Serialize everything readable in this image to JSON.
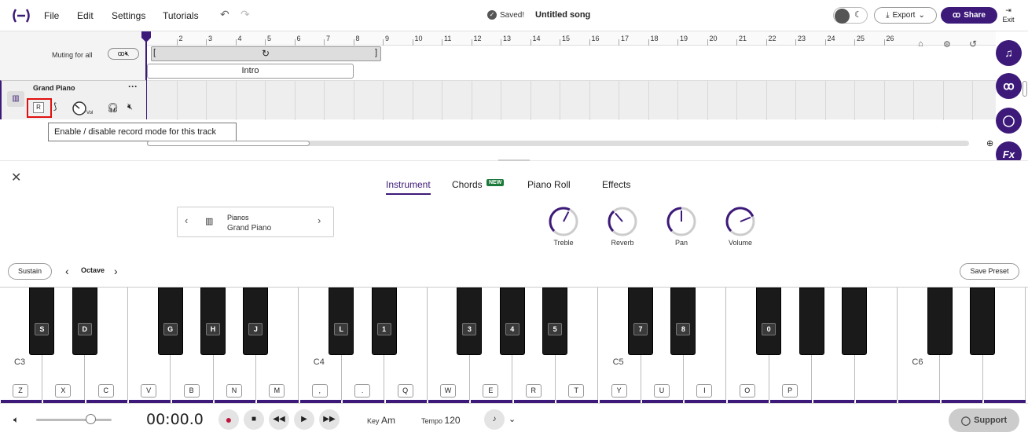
{
  "header": {
    "menu": [
      "File",
      "Edit",
      "Settings",
      "Tutorials"
    ],
    "saved": "Saved!",
    "song_title": "Untitled song",
    "export": "Export",
    "share": "Share",
    "exit": "Exit"
  },
  "timeline": {
    "ticks": [
      "2",
      "3",
      "4",
      "5",
      "6",
      "7",
      "8",
      "9",
      "10",
      "11",
      "12",
      "13",
      "14",
      "15",
      "16",
      "17",
      "18",
      "19",
      "20",
      "21",
      "22",
      "23",
      "24",
      "25",
      "26"
    ],
    "muting_label": "Muting for all",
    "section": "Intro"
  },
  "track": {
    "name": "Grand Piano",
    "record_label": "R",
    "vol_label": "Vol",
    "tooltip": "Enable / disable record mode for this track"
  },
  "panel": {
    "tabs": [
      "Instrument",
      "Chords",
      "Piano Roll",
      "Effects"
    ],
    "new_badge": "NEW",
    "instrument_category": "Pianos",
    "instrument_name": "Grand Piano",
    "knobs": [
      {
        "label": "Treble",
        "level": 0.6
      },
      {
        "label": "Reverb",
        "level": 0.35
      },
      {
        "label": "Pan",
        "level": 0.5
      },
      {
        "label": "Volume",
        "level": 0.75
      }
    ],
    "sustain": "Sustain",
    "octave": "Octave",
    "save_preset": "Save Preset"
  },
  "keyboard": {
    "white_labels": [
      "Z",
      "X",
      "C",
      "V",
      "B",
      "N",
      "M",
      ",",
      ".",
      "Q",
      "W",
      "E",
      "R",
      "T",
      "Y",
      "U",
      "I",
      "O",
      "P"
    ],
    "black_labels": [
      "S",
      "D",
      "G",
      "H",
      "J",
      "L",
      "1",
      "3",
      "4",
      "5",
      "7",
      "8",
      "0"
    ],
    "octave_labels": [
      "C3",
      "C4",
      "C5",
      "C6"
    ]
  },
  "transport": {
    "time": "00:00.0",
    "key_label": "Key",
    "key_value": "Am",
    "tempo_label": "Tempo",
    "tempo_value": "120",
    "support": "Support"
  },
  "colors": {
    "accent": "#3d1a7a",
    "highlight": "#e01010"
  }
}
